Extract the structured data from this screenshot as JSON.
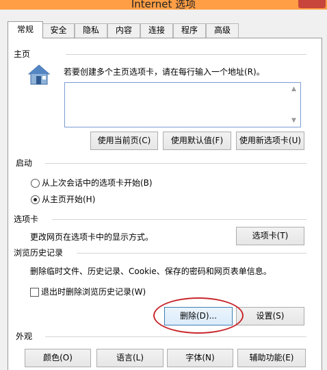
{
  "window": {
    "title": "Internet 选项"
  },
  "tabs": [
    {
      "label": "常规",
      "active": true
    },
    {
      "label": "安全"
    },
    {
      "label": "隐私"
    },
    {
      "label": "内容"
    },
    {
      "label": "连接"
    },
    {
      "label": "程序"
    },
    {
      "label": "高级"
    }
  ],
  "home": {
    "heading": "主页",
    "instruction": "若要创建多个主页选项卡，请在每行输入一个地址(R)。",
    "url_value": "",
    "use_current_label": "使用当前页(C)",
    "use_default_label": "使用默认值(F)",
    "use_new_tab_label": "使用新选项卡(U)",
    "icon": "home-icon"
  },
  "startup": {
    "heading": "启动",
    "option_last_session": "从上次会话中的选项卡开始(B)",
    "option_home": "从主页开始(H)",
    "selected": "option_home"
  },
  "tabs_section": {
    "heading": "选项卡",
    "description": "更改网页在选项卡中的显示方式。",
    "button_label": "选项卡(T)"
  },
  "history": {
    "heading": "浏览历史记录",
    "description": "删除临时文件、历史记录、Cookie、保存的密码和网页表单信息。",
    "delete_on_exit_label": "退出时删除浏览历史记录(W)",
    "delete_on_exit_checked": false,
    "delete_label": "删除(D)...",
    "settings_label": "设置(S)"
  },
  "appearance": {
    "heading": "外观",
    "colors_label": "颜色(O)",
    "languages_label": "语言(L)",
    "fonts_label": "字体(N)",
    "accessibility_label": "辅助功能(E)"
  },
  "colors": {
    "title_bar": "#ff9e44",
    "highlight": "#c8262b",
    "accent_border": "#3c7fb1"
  }
}
